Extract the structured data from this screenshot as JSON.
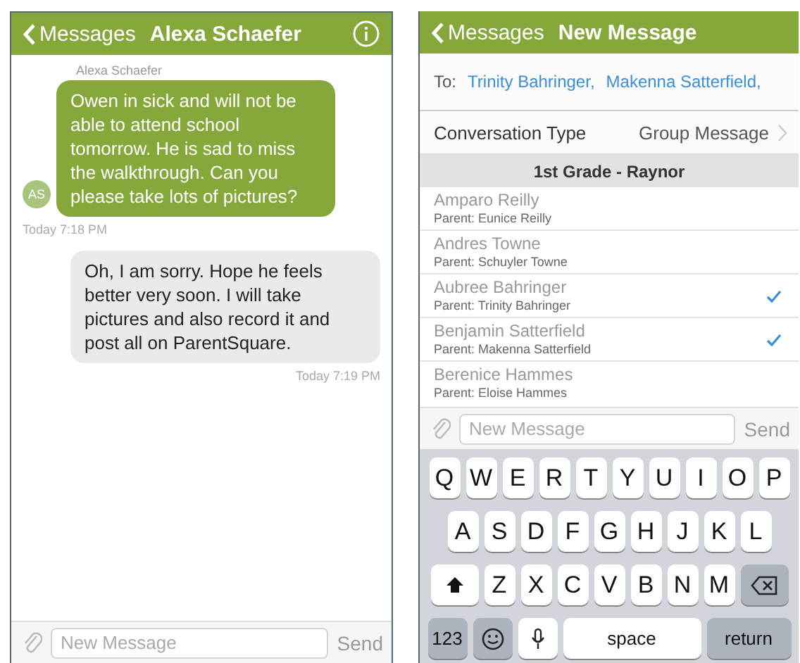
{
  "chat": {
    "header": {
      "back": "Messages",
      "title": "Alexa Schaefer"
    },
    "messages": [
      {
        "kind": "incoming",
        "sender": "Alexa Schaefer",
        "avatar": "AS",
        "text": "Owen in sick and will not be able to attend school tomorrow. He is sad to miss the walkthrough. Can you please take lots of pictures?",
        "time": "Today 7:18 PM"
      },
      {
        "kind": "outgoing",
        "text": "Oh, I am sorry. Hope he feels better very soon. I will take pictures and also record it and post all on ParentSquare.",
        "time": "Today 7:19 PM"
      }
    ],
    "compose": {
      "placeholder": "New Message",
      "send": "Send"
    }
  },
  "new_message": {
    "header": {
      "back": "Messages",
      "title": "New Message"
    },
    "to_label": "To:",
    "recipients": [
      "Trinity Bahringer,",
      "Makenna Satterfield,"
    ],
    "conversation_type": {
      "label": "Conversation Type",
      "value": "Group Message"
    },
    "section": "1st Grade - Raynor",
    "students": [
      {
        "name": "Amparo Reilly",
        "parent": "Parent: Eunice Reilly",
        "selected": false
      },
      {
        "name": "Andres Towne",
        "parent": "Parent: Schuyler Towne",
        "selected": false
      },
      {
        "name": "Aubree Bahringer",
        "parent": "Parent: Trinity Bahringer",
        "selected": true
      },
      {
        "name": "Benjamin Satterfield",
        "parent": "Parent: Makenna Satterfield",
        "selected": true
      },
      {
        "name": "Berenice Hammes",
        "parent": "Parent: Eloise Hammes",
        "selected": false
      }
    ],
    "compose": {
      "placeholder": "New Message",
      "send": "Send"
    },
    "keyboard": [
      [
        {
          "kind": "letter",
          "label": "Q"
        },
        {
          "kind": "letter",
          "label": "W"
        },
        {
          "kind": "letter",
          "label": "E"
        },
        {
          "kind": "letter",
          "label": "R"
        },
        {
          "kind": "letter",
          "label": "T"
        },
        {
          "kind": "letter",
          "label": "Y"
        },
        {
          "kind": "letter",
          "label": "U"
        },
        {
          "kind": "letter",
          "label": "I"
        },
        {
          "kind": "letter",
          "label": "O"
        },
        {
          "kind": "letter",
          "label": "P"
        }
      ],
      [
        {
          "kind": "letter",
          "label": "A"
        },
        {
          "kind": "letter",
          "label": "S"
        },
        {
          "kind": "letter",
          "label": "D"
        },
        {
          "kind": "letter",
          "label": "F"
        },
        {
          "kind": "letter",
          "label": "G"
        },
        {
          "kind": "letter",
          "label": "H"
        },
        {
          "kind": "letter",
          "label": "J"
        },
        {
          "kind": "letter",
          "label": "K"
        },
        {
          "kind": "letter",
          "label": "L"
        }
      ],
      [
        {
          "kind": "shift"
        },
        {
          "kind": "letter",
          "label": "Z"
        },
        {
          "kind": "letter",
          "label": "X"
        },
        {
          "kind": "letter",
          "label": "C"
        },
        {
          "kind": "letter",
          "label": "V"
        },
        {
          "kind": "letter",
          "label": "B"
        },
        {
          "kind": "letter",
          "label": "N"
        },
        {
          "kind": "letter",
          "label": "M"
        },
        {
          "kind": "delete"
        }
      ],
      [
        {
          "kind": "mode",
          "label": "123"
        },
        {
          "kind": "emoji"
        },
        {
          "kind": "mic"
        },
        {
          "kind": "space",
          "label": "space"
        },
        {
          "kind": "return",
          "label": "return"
        }
      ]
    ]
  }
}
